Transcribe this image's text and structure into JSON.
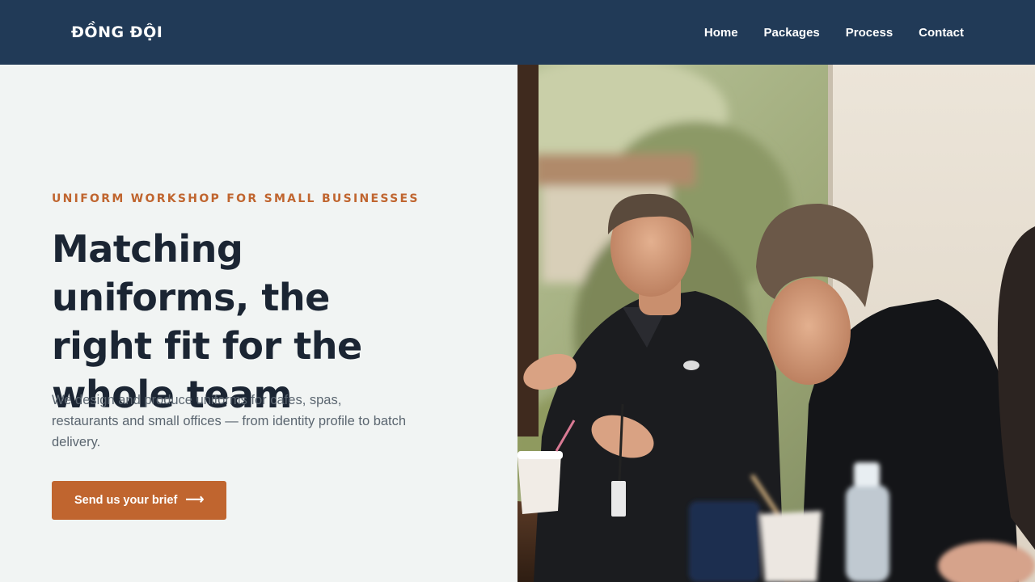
{
  "header": {
    "brand": "ĐỒNG ĐỘI",
    "nav": [
      "Home",
      "Packages",
      "Process",
      "Contact"
    ]
  },
  "hero": {
    "eyebrow": "UNIFORM WORKSHOP FOR SMALL BUSINESSES",
    "headline": "Matching uniforms, the right fit for the whole team",
    "lede": "We design and produce uniforms for cafes, spas, restaurants and small offices — from identity profile to batch delivery.",
    "cta_label": "Send us your brief",
    "cta_icon": "arrow-right-icon"
  },
  "colors": {
    "header_bg": "#213a57",
    "accent": "#c0652f",
    "page_bg": "#f1f4f3",
    "heading": "#1b2533",
    "body_text": "#5b6670"
  }
}
